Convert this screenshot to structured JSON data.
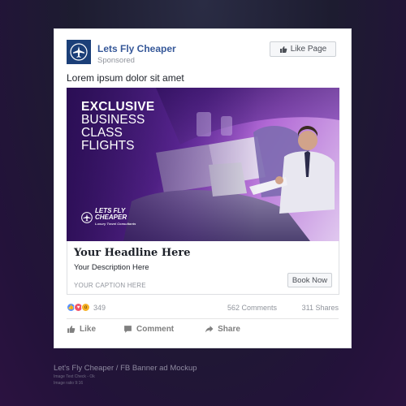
{
  "post": {
    "page_name": "Lets Fly Cheaper",
    "sponsored": "Sponsored",
    "like_page": "Like Page",
    "text": "Lorem ipsum dolor sit amet"
  },
  "ad_image": {
    "line1": "EXCLUSIVE",
    "line2": "BUSINESS",
    "line3": "CLASS",
    "line4": "FLIGHTS",
    "logo_line1": "LETS FLY",
    "logo_line2": "CHEAPER",
    "logo_tagline": "Luxury Travel Consultants"
  },
  "link": {
    "headline": "Your Headline Here",
    "description": "Your Description Here",
    "caption": "YOUR CAPTION HERE",
    "cta": "Book Now"
  },
  "stats": {
    "reaction_count": "349",
    "comments": "562 Comments",
    "shares": "311 Shares"
  },
  "actions": {
    "like": "Like",
    "comment": "Comment",
    "share": "Share"
  },
  "footer": {
    "title": "Let's Fly Cheaper / FB Banner ad Mockup",
    "check": "Image Text Check - Ok",
    "ratio": "Image ratio 9:16"
  },
  "colors": {
    "link_blue": "#365899",
    "avatar_bg": "#1b3f78",
    "like_blue": "#5890ff",
    "love_red": "#f25268",
    "wow_yellow": "#f7b125"
  }
}
